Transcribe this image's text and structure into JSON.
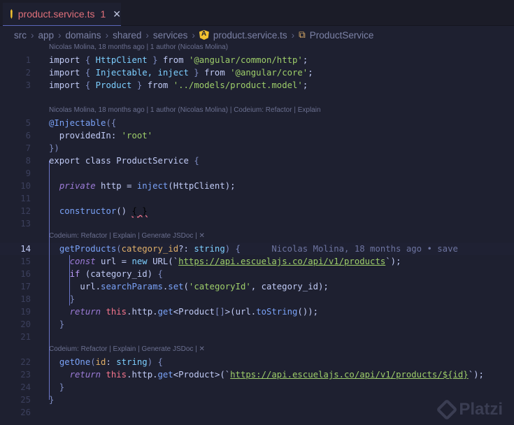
{
  "tab": {
    "filename": "product.service.ts",
    "problems": "1",
    "close": "✕"
  },
  "breadcrumb": [
    "src",
    "app",
    "domains",
    "shared",
    "services",
    "product.service.ts",
    "ProductService"
  ],
  "rows": [
    {
      "lens": "Nicolas Molina, 18 months ago | 1 author (Nicolas Molina)"
    },
    {
      "n": "1",
      "t": [
        [
          "import ",
          "kw"
        ],
        [
          "{ ",
          "br"
        ],
        [
          "HttpClient",
          "ty"
        ],
        [
          " } ",
          "br"
        ],
        [
          "from ",
          "kw"
        ],
        [
          "'@angular/common/http'",
          "st"
        ],
        [
          ";",
          "pl"
        ]
      ]
    },
    {
      "n": "2",
      "t": [
        [
          "import ",
          "kw"
        ],
        [
          "{ ",
          "br"
        ],
        [
          "Injectable, inject",
          "ty"
        ],
        [
          " } ",
          "br"
        ],
        [
          "from ",
          "kw"
        ],
        [
          "'@angular/core'",
          "st"
        ],
        [
          ";",
          "pl"
        ]
      ]
    },
    {
      "n": "3",
      "t": [
        [
          "import ",
          "kw"
        ],
        [
          "{ ",
          "br"
        ],
        [
          "Product",
          "ty"
        ],
        [
          " } ",
          "br"
        ],
        [
          "from ",
          "kw"
        ],
        [
          "'../models/product.model'",
          "st"
        ],
        [
          ";",
          "pl"
        ]
      ]
    },
    {
      "n": "",
      "t": []
    },
    {
      "lens": "Nicolas Molina, 18 months ago | 1 author (Nicolas Molina) | Codeium: Refactor | Explain"
    },
    {
      "n": "5",
      "t": [
        [
          "@Injectable",
          "fn"
        ],
        [
          "({",
          "br"
        ]
      ]
    },
    {
      "n": "6",
      "t": [
        [
          "  providedIn: ",
          "pl"
        ],
        [
          "'root'",
          "st"
        ]
      ]
    },
    {
      "n": "7",
      "t": [
        [
          "})",
          "br"
        ]
      ]
    },
    {
      "n": "8",
      "t": [
        [
          "export class ",
          "kw"
        ],
        [
          "ProductService ",
          "cls"
        ],
        [
          "{",
          "br"
        ]
      ]
    },
    {
      "n": "9",
      "t": []
    },
    {
      "n": "10",
      "t": [
        [
          "  ",
          "pl"
        ],
        [
          "private ",
          "it"
        ],
        [
          "http = ",
          "pl"
        ],
        [
          "inject",
          "fn"
        ],
        [
          "(HttpClient);",
          "pl"
        ]
      ]
    },
    {
      "n": "11",
      "t": []
    },
    {
      "n": "12",
      "t": [
        [
          "  ",
          "pl"
        ],
        [
          "constructor",
          "fn"
        ],
        [
          "() ",
          "pl"
        ],
        [
          "{ }",
          "sq"
        ]
      ]
    },
    {
      "n": "13",
      "t": []
    },
    {
      "lens": "Codeium: Refactor | Explain | Generate JSDoc | ✕"
    },
    {
      "n": "14",
      "cur": true,
      "t": [
        [
          "  ",
          "pl"
        ],
        [
          "getProducts",
          "fn"
        ],
        [
          "(",
          "br"
        ],
        [
          "category_id",
          "pa"
        ],
        [
          "?: ",
          "pl"
        ],
        [
          "string",
          "ty"
        ],
        [
          ") {",
          "br"
        ],
        [
          "      Nicolas Molina, 18 months ago • save",
          "blame"
        ]
      ]
    },
    {
      "n": "15",
      "t": [
        [
          "    ",
          "pl"
        ],
        [
          "const ",
          "it"
        ],
        [
          "url = ",
          "pl"
        ],
        [
          "new ",
          "ty"
        ],
        [
          "URL(`",
          "pl"
        ],
        [
          "https://api.escuelajs.co/api/v1/products",
          "url"
        ],
        [
          "`);",
          "pl"
        ]
      ]
    },
    {
      "n": "16",
      "t": [
        [
          "    ",
          "pl"
        ],
        [
          "if ",
          "dec"
        ],
        [
          "(category_id) ",
          "pl"
        ],
        [
          "{",
          "br"
        ]
      ]
    },
    {
      "n": "17",
      "t": [
        [
          "      url.",
          "pl"
        ],
        [
          "searchParams",
          "fn"
        ],
        [
          ".",
          "pl"
        ],
        [
          "set",
          "fn"
        ],
        [
          "(",
          "pl"
        ],
        [
          "'categoryId'",
          "st"
        ],
        [
          ", category_id);",
          "pl"
        ]
      ]
    },
    {
      "n": "18",
      "t": [
        [
          "    }",
          "br"
        ]
      ]
    },
    {
      "n": "19",
      "t": [
        [
          "    ",
          "pl"
        ],
        [
          "return ",
          "it"
        ],
        [
          "this",
          "th"
        ],
        [
          ".http.",
          "pl"
        ],
        [
          "get",
          "fn"
        ],
        [
          "<Product",
          "pl"
        ],
        [
          "[]",
          "br"
        ],
        [
          ">(url.",
          "pl"
        ],
        [
          "toString",
          "fn"
        ],
        [
          "());",
          "pl"
        ]
      ]
    },
    {
      "n": "20",
      "t": [
        [
          "  }",
          "br"
        ]
      ]
    },
    {
      "n": "21",
      "t": []
    },
    {
      "lens": "Codeium: Refactor | Explain | Generate JSDoc | ✕"
    },
    {
      "n": "22",
      "t": [
        [
          "  ",
          "pl"
        ],
        [
          "getOne",
          "fn"
        ],
        [
          "(",
          "br"
        ],
        [
          "id",
          "pa"
        ],
        [
          ": ",
          "pl"
        ],
        [
          "string",
          "ty"
        ],
        [
          ") {",
          "br"
        ]
      ]
    },
    {
      "n": "23",
      "t": [
        [
          "    ",
          "pl"
        ],
        [
          "return ",
          "it"
        ],
        [
          "this",
          "th"
        ],
        [
          ".http.",
          "pl"
        ],
        [
          "get",
          "fn"
        ],
        [
          "<Product>(`",
          "pl"
        ],
        [
          "https://api.escuelajs.co/api/v1/products/${id}",
          "url"
        ],
        [
          "`);",
          "pl"
        ]
      ]
    },
    {
      "n": "24",
      "t": [
        [
          "  }",
          "br"
        ]
      ]
    },
    {
      "n": "25",
      "t": [
        [
          "}",
          "br"
        ]
      ]
    },
    {
      "n": "26",
      "t": []
    }
  ],
  "watermark": "Platzi"
}
